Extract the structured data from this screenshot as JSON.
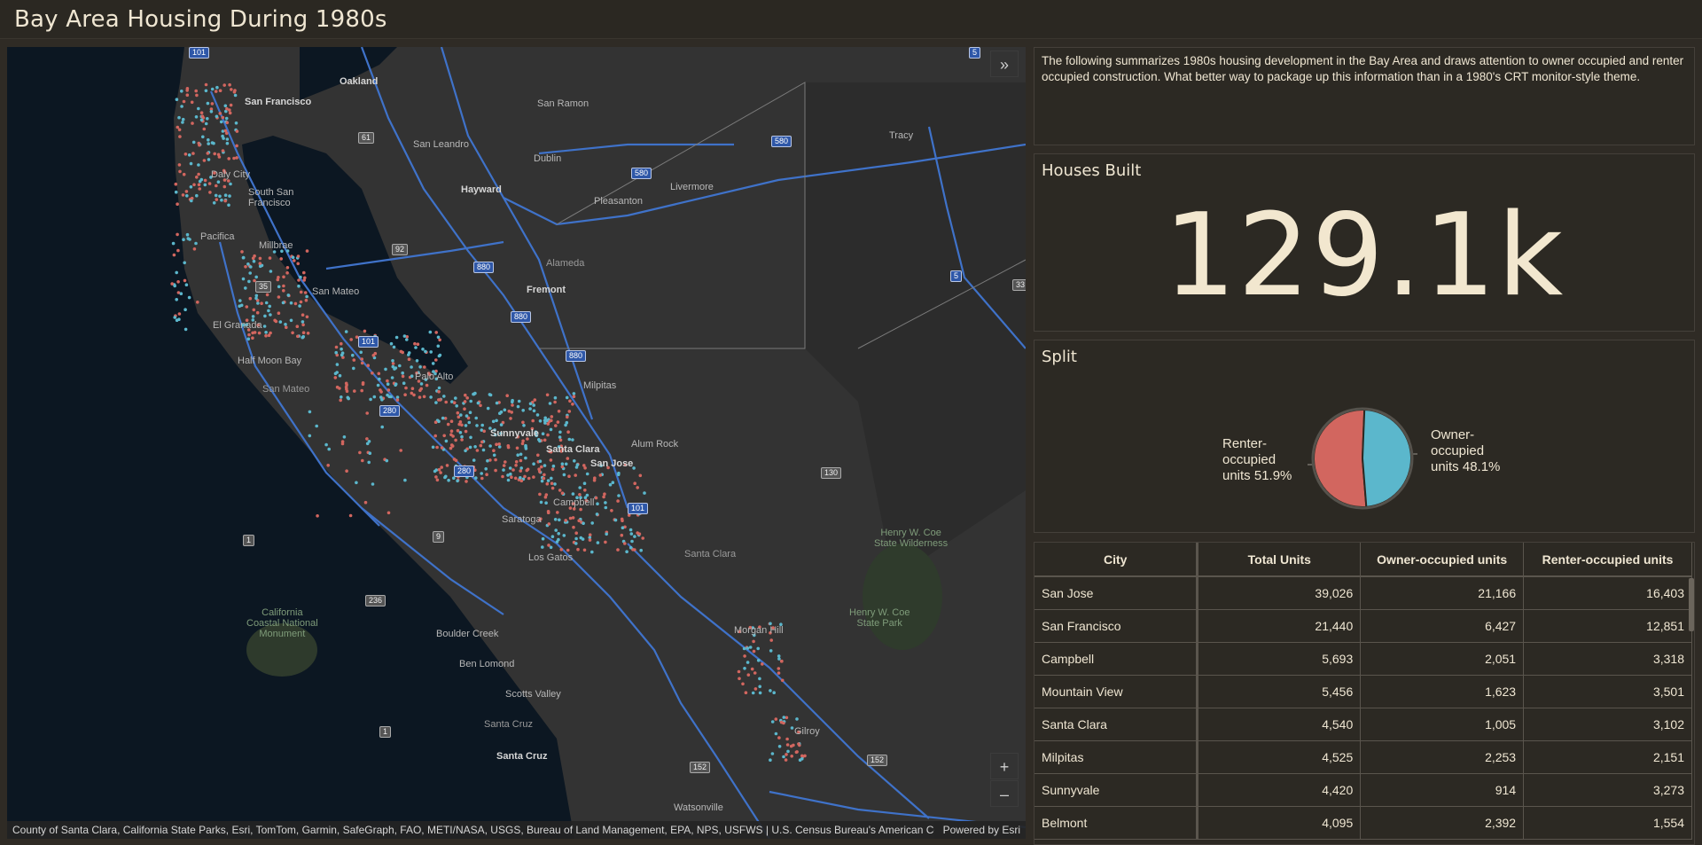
{
  "header": {
    "title": "Bay Area Housing During 1980s"
  },
  "intro": {
    "text": "The following summarizes 1980s housing development in the Bay Area and draws attention to owner occupied and renter occupied construction. What better way to package up this information than in a 1980's CRT monitor-style theme."
  },
  "houses_built": {
    "title": "Houses Built",
    "value": "129.1k"
  },
  "split": {
    "title": "Split",
    "renter_label": "Renter-\noccupied\nunits 51.9%",
    "owner_label": "Owner-\noccupied\nunits 48.1%",
    "renter_color": "#d2665f",
    "owner_color": "#5bb7cc"
  },
  "chart_data": {
    "type": "pie",
    "title": "Split",
    "slices": [
      {
        "name": "Renter-occupied units",
        "value": 51.9,
        "color": "#d2665f"
      },
      {
        "name": "Owner-occupied units",
        "value": 48.1,
        "color": "#5bb7cc"
      }
    ]
  },
  "table": {
    "headers": [
      "City",
      "Total Units",
      "Owner-occupied units",
      "Renter-occupied units"
    ],
    "rows": [
      [
        "San Jose",
        "39,026",
        "21,166",
        "16,403"
      ],
      [
        "San Francisco",
        "21,440",
        "6,427",
        "12,851"
      ],
      [
        "Campbell",
        "5,693",
        "2,051",
        "3,318"
      ],
      [
        "Mountain View",
        "5,456",
        "1,623",
        "3,501"
      ],
      [
        "Santa Clara",
        "4,540",
        "1,005",
        "3,102"
      ],
      [
        "Milpitas",
        "4,525",
        "2,253",
        "2,151"
      ],
      [
        "Sunnyvale",
        "4,420",
        "914",
        "3,273"
      ],
      [
        "Belmont",
        "4,095",
        "2,392",
        "1,554"
      ]
    ]
  },
  "map": {
    "attribution": "County of Santa Clara, California State Parks, Esri, TomTom, Garmin, SafeGraph, FAO, METI/NASA, USGS, Bureau of Land Management, EPA, NPS, USFWS | U.S. Census Bureau's American Co...",
    "powered_by": "Powered by Esri",
    "zoom_in": "+",
    "zoom_out": "–",
    "collapse": "»",
    "labels": {
      "oakland": "Oakland",
      "san_francisco": "San Francisco",
      "san_ramon": "San Ramon",
      "san_leandro": "San Leandro",
      "dublin": "Dublin",
      "tracy": "Tracy",
      "daly_city": "Daly City",
      "south_sf": "South San\nFrancisco",
      "hayward": "Hayward",
      "pleasanton": "Pleasanton",
      "livermore": "Livermore",
      "pacifica": "Pacifica",
      "millbrae": "Millbrae",
      "alameda": "Alameda",
      "fremont": "Fremont",
      "san_mateo_city": "San Mateo",
      "el_granada": "El Granada",
      "half_moon_bay": "Half Moon Bay",
      "san_mateo": "San Mateo",
      "palo_alto": "Palo Alto",
      "milpitas": "Milpitas",
      "sunnyvale": "Sunnyvale",
      "santa_clara": "Santa Clara",
      "alum_rock": "Alum Rock",
      "san_jose": "San Jose",
      "campbell": "Campbell",
      "saratoga": "Saratoga",
      "los_gatos": "Los Gatos",
      "santa_clara_county": "Santa Clara",
      "henry_coe": "Henry W. Coe\nState Wilderness",
      "henry_coe_park": "Henry W. Coe\nState Park",
      "morgan_hill": "Morgan Hill",
      "california_coastal": "California\nCoastal National\nMonument",
      "boulder_creek": "Boulder Creek",
      "ben_lomond": "Ben Lomond",
      "scotts_valley": "Scotts Valley",
      "santa_cruz_county": "Santa Cruz",
      "santa_cruz": "Santa Cruz",
      "gilroy": "Gilroy",
      "watsonville": "Watsonville"
    },
    "shields": {
      "i580a": "580",
      "i580b": "580",
      "i880a": "880",
      "i880b": "880",
      "i880c": "880",
      "i5a": "5",
      "i5b": "5",
      "us101a": "101",
      "us101b": "101",
      "us101c": "101",
      "i280a": "280",
      "i280b": "280",
      "s92": "92",
      "s35": "35",
      "s61": "61",
      "s130": "130",
      "s1a": "1",
      "s1b": "1",
      "s9": "9",
      "s236": "236",
      "s152a": "152",
      "s152b": "152",
      "s33": "33"
    }
  }
}
